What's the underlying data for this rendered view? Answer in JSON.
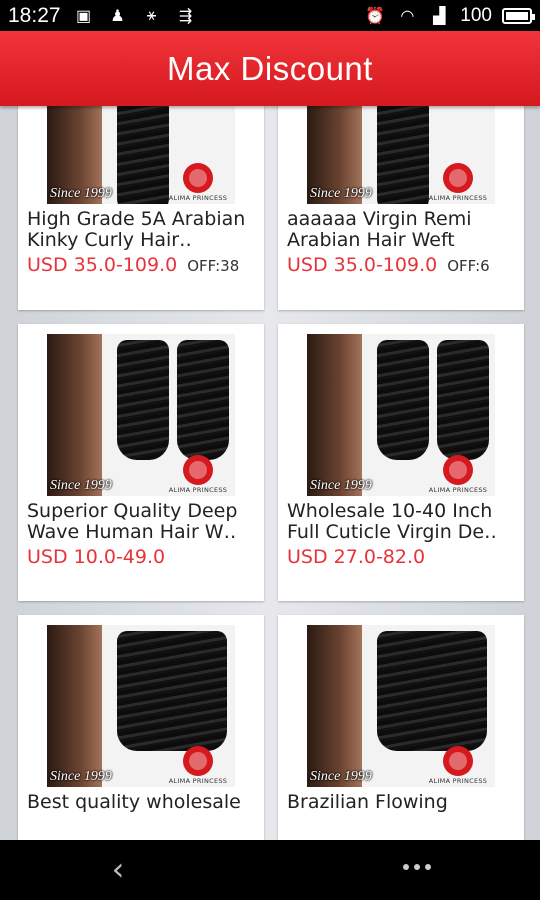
{
  "status_bar": {
    "time": "18:27",
    "left_icons": [
      "image-icon",
      "notification-icon",
      "usb-share-icon",
      "usb-icon"
    ],
    "right_icons": [
      "alarm-icon",
      "wifi-icon",
      "signal-3g-icon"
    ],
    "battery": "100"
  },
  "header": {
    "title": "Max Discount",
    "color": "#e4232a"
  },
  "products": [
    {
      "title": "High Grade 5A Arabian Kinky Curly Hair‥",
      "price": "USD 35.0-109.0",
      "off": "OFF:38",
      "since": "Since 1999",
      "brand": "ALIMA PRINCESS"
    },
    {
      "title": "aaaaaa Virgin Remi Arabian Hair Weft",
      "price": "USD 35.0-109.0",
      "off": "OFF:6",
      "since": "Since 1999",
      "brand": "ALIMA PRINCESS"
    },
    {
      "title": "Superior Quality Deep Wave Human Hair W‥",
      "price": "USD 10.0-49.0",
      "off": "",
      "since": "Since 1999",
      "brand": "ALIMA PRINCESS"
    },
    {
      "title": "Wholesale 10-40 Inch Full Cuticle Virgin De‥",
      "price": "USD 27.0-82.0",
      "off": "",
      "since": "Since 1999",
      "brand": "ALIMA PRINCESS"
    },
    {
      "title": "Best quality wholesale",
      "price": "",
      "off": "",
      "since": "Since 1999",
      "brand": "ALIMA PRINCESS"
    },
    {
      "title": "Brazilian Flowing",
      "price": "",
      "off": "",
      "since": "Since 1999",
      "brand": "ALIMA PRINCESS"
    }
  ],
  "nav": {
    "back_icon": "back-icon",
    "more_icon": "more-icon"
  },
  "colors": {
    "price": "#e8333a",
    "header": "#e4232a"
  }
}
